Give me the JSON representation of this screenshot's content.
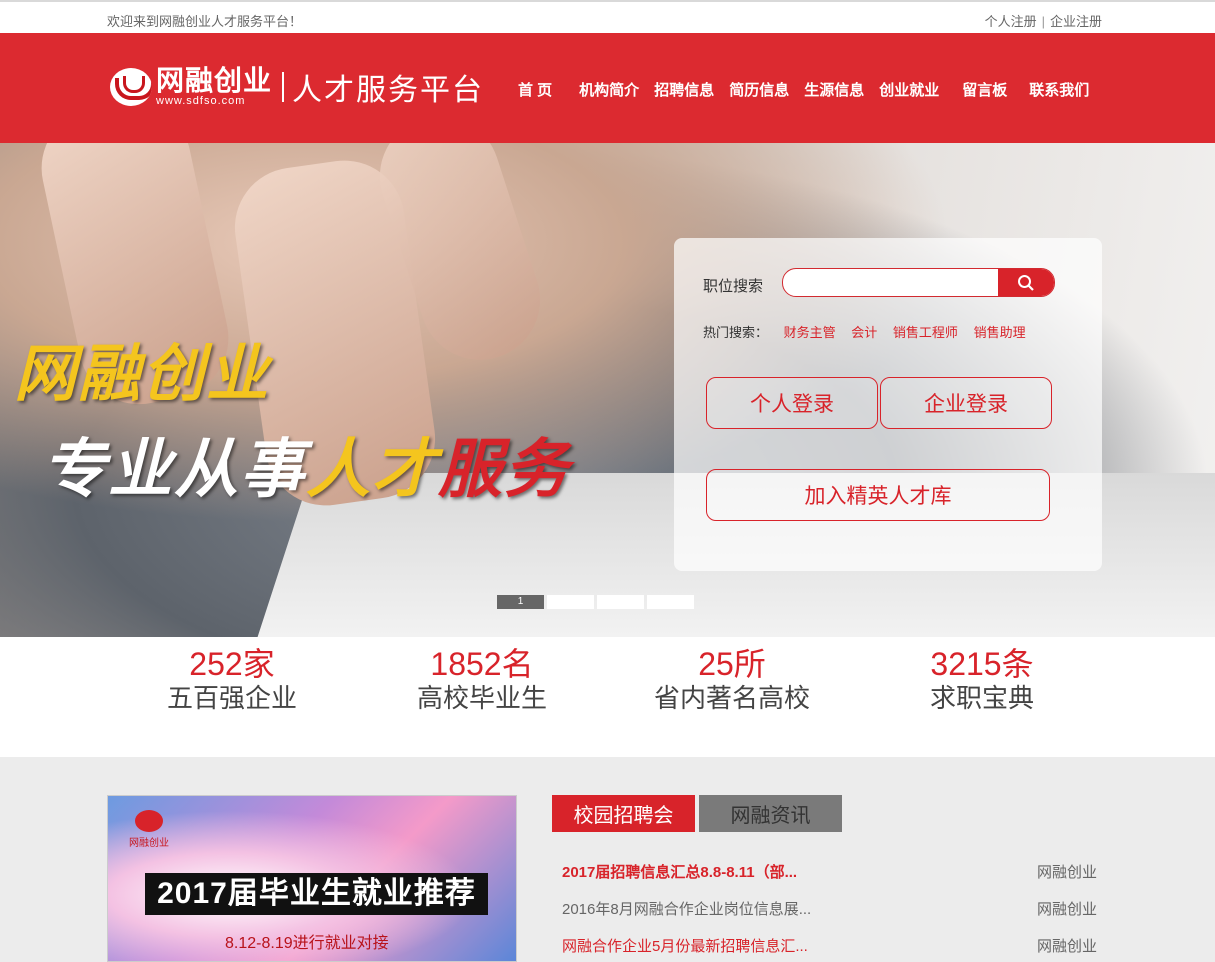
{
  "topbar": {
    "welcome": "欢迎来到网融创业人才服务平台！",
    "personal_register": "个人注册",
    "separator": "|",
    "company_register": "企业注册"
  },
  "header": {
    "logo_cn": "网融创业",
    "logo_url": "www.sdfso.com",
    "slogan": "人才服务平台",
    "nav": [
      "首 页",
      "机构简介",
      "招聘信息",
      "简历信息",
      "生源信息",
      "创业就业",
      "留言板",
      "联系我们"
    ]
  },
  "banner": {
    "line1": "网融创业",
    "line2_a": "专业从事",
    "line2_b": "人才",
    "line2_c": "服务",
    "search_label": "职位搜索",
    "search_placeholder": "",
    "hot_label": "热门搜索：",
    "hot_keywords": [
      "财务主管",
      "会计",
      "销售工程师",
      "销售助理"
    ],
    "personal_login": "个人登录",
    "company_login": "企业登录",
    "join_talent_pool": "加入精英人才库",
    "active_slide": "1"
  },
  "stats": [
    {
      "num": "252家",
      "label": "五百强企业"
    },
    {
      "num": "1852名",
      "label": "高校毕业生"
    },
    {
      "num": "25所",
      "label": "省内著名高校"
    },
    {
      "num": "3215条",
      "label": "求职宝典"
    }
  ],
  "promo": {
    "logo_text": "网融创业",
    "title": "2017届毕业生就业推荐",
    "subtitle": "8.12-8.19进行就业对接"
  },
  "tabs": {
    "campus": "校园招聘会",
    "news": "网融资讯"
  },
  "news": [
    {
      "title": "2017届招聘信息汇总8.8-8.11（部...",
      "source": "网融创业"
    },
    {
      "title": "2016年8月网融合作企业岗位信息展...",
      "source": "网融创业"
    },
    {
      "title": "网融合作企业5月份最新招聘信息汇...",
      "source": "网融创业"
    }
  ],
  "colors": {
    "brand_red": "#dc2a30",
    "accent_red": "#d8232a"
  }
}
